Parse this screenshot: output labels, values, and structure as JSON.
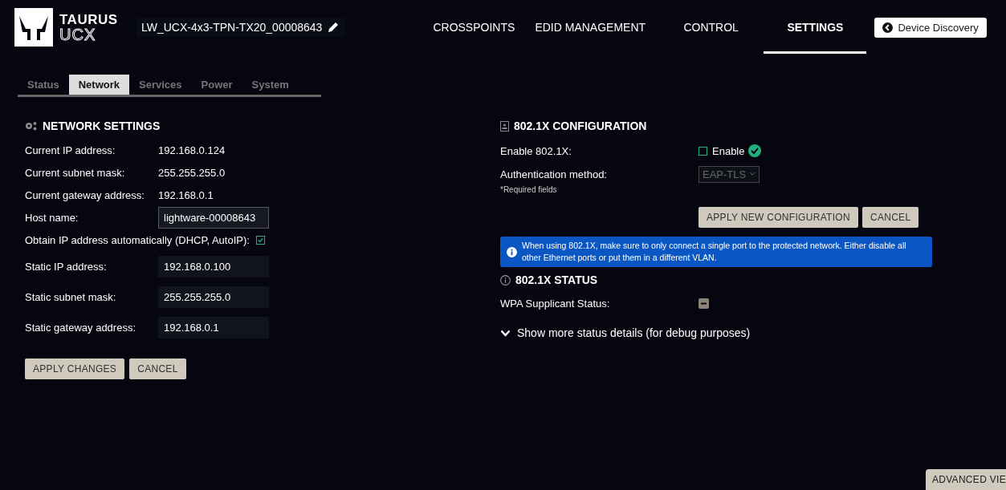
{
  "header": {
    "logo": {
      "line_1": "TAURUS",
      "line_2": "UCX"
    },
    "device_name": "LW_UCX-4x3-TPN-TX20_00008643",
    "nav": [
      {
        "label": "CROSSPOINTS",
        "selected": false
      },
      {
        "label": "EDID MANAGEMENT",
        "selected": false
      },
      {
        "label": "CONTROL",
        "selected": false
      },
      {
        "label": "SETTINGS",
        "selected": true
      }
    ],
    "device_discovery": "Device Discovery"
  },
  "tabs": [
    {
      "label": "Status",
      "selected": false
    },
    {
      "label": "Network",
      "selected": true
    },
    {
      "label": "Services",
      "selected": false
    },
    {
      "label": "Power",
      "selected": false
    },
    {
      "label": "System",
      "selected": false
    }
  ],
  "network_settings": {
    "title": "NETWORK SETTINGS",
    "info_rows": [
      {
        "label": "Current IP address:",
        "value": "192.168.0.124"
      },
      {
        "label": "Current subnet mask:",
        "value": "255.255.255.0"
      },
      {
        "label": "Current gateway address:",
        "value": "192.168.0.1"
      }
    ],
    "host_name": {
      "label": "Host name:",
      "value": "lightware-00008643"
    },
    "dhcp": {
      "label": "Obtain IP address automatically (DHCP, AutoIP):",
      "checked": true
    },
    "static_fields": [
      {
        "label": "Static IP address:",
        "value": "192.168.0.100"
      },
      {
        "label": "Static subnet mask:",
        "value": "255.255.255.0"
      },
      {
        "label": "Static gateway address:",
        "value": "192.168.0.1"
      }
    ],
    "buttons": [
      "APPLY CHANGES",
      "CANCEL"
    ]
  },
  "dot1x_config": {
    "title": "802.1X CONFIGURATION",
    "enable": {
      "label": "Enable 802.1X:",
      "option": "Enable",
      "checked": false
    },
    "auth": {
      "label": "Authentication method:",
      "value": "EAP-TLS",
      "disabled": true
    },
    "required_note": "*Required fields",
    "buttons": [
      "APPLY NEW CONFIGURATION",
      "CANCEL"
    ],
    "info": "When using 802.1X, make sure to only connect a single port to the protected network. Either disable all other Ethernet ports or put them in a different VLAN."
  },
  "dot1x_status": {
    "title": "802.1X STATUS",
    "rows": [
      {
        "label": "WPA Supplicant Status:"
      }
    ],
    "details_toggle": {
      "label": "Show more status details (for debug purposes)",
      "expanded": false
    }
  },
  "advanced_view": "ADVANCED VIE"
}
